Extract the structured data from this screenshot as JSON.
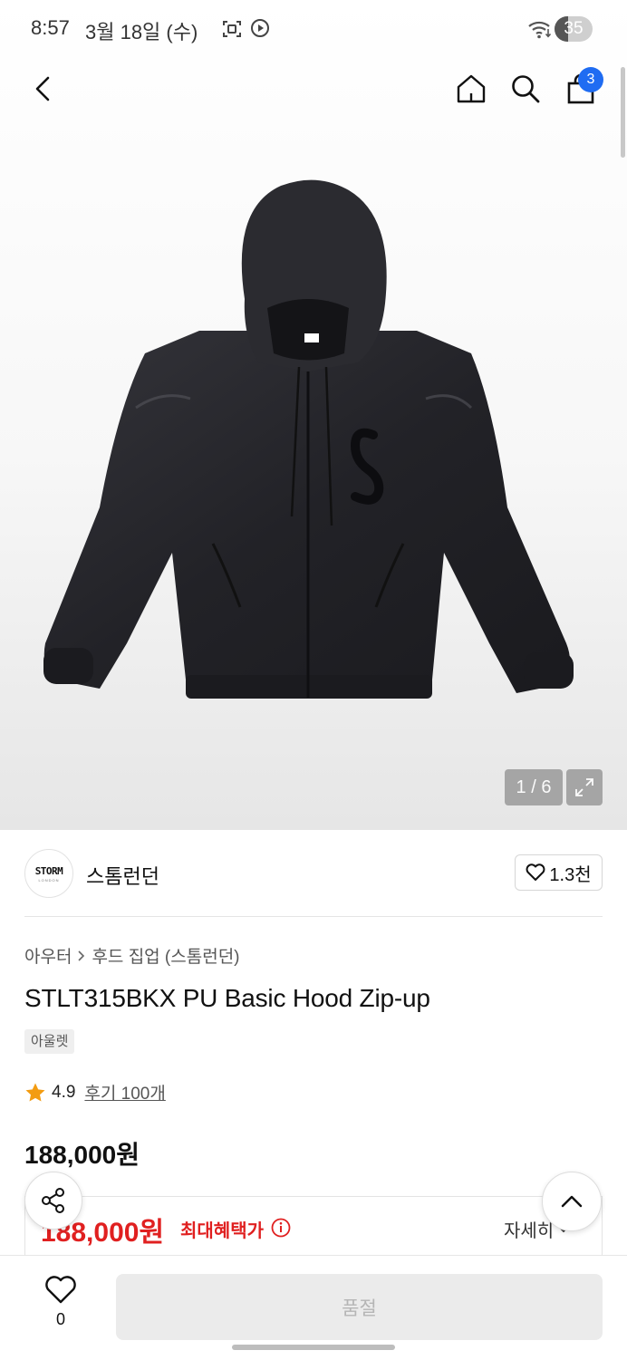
{
  "status_bar": {
    "time": "8:57",
    "date": "3월 18일 (수)",
    "battery": "35"
  },
  "header": {
    "cart_count": "3"
  },
  "gallery": {
    "counter": "1 / 6",
    "image_alt": "black PU hooded zip-up jacket"
  },
  "brand": {
    "logo_text": "STORM",
    "logo_subtext": "LONDON",
    "name": "스톰런던",
    "likes": "1.3천"
  },
  "product": {
    "breadcrumb_category": "아우터",
    "breadcrumb_sub": "후드 집업 (스톰런던)",
    "title": "STLT315BKX PU Basic Hood Zip-up",
    "tag": "아울렛",
    "rating": "4.9",
    "review_link": "후기 100개",
    "price": "188,000원"
  },
  "benefit": {
    "price": "188,000원",
    "label": "최대혜택가",
    "detail_label": "자세히"
  },
  "bottom_bar": {
    "wish_count": "0",
    "buy_label": "품절"
  },
  "colors": {
    "accent_red": "#e02020",
    "badge_blue": "#1f6cf2"
  }
}
